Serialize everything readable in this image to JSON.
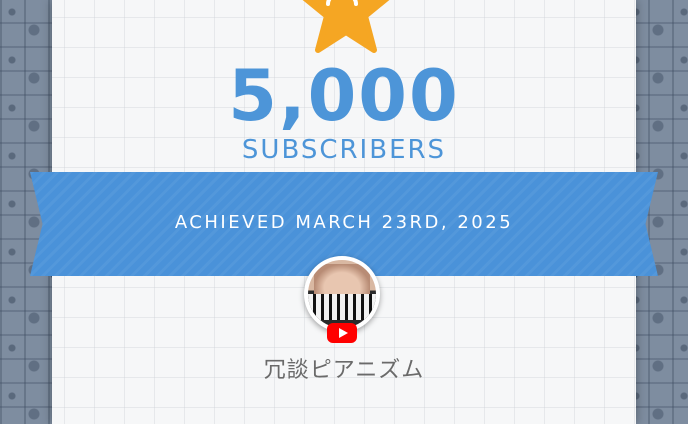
{
  "milestone": {
    "count": "5,000",
    "label": "SUBSCRIBERS",
    "achieved_text": "ACHIEVED MARCH 23RD, 2025"
  },
  "channel": {
    "name": "冗談ピアニズム",
    "platform_icon": "youtube-icon"
  },
  "icons": {
    "badge": "add-user-star-icon"
  },
  "colors": {
    "accent": "#4d95d8",
    "ribbon": "#4a92d9",
    "star": "#f5a623",
    "youtube": "#ff0000"
  }
}
